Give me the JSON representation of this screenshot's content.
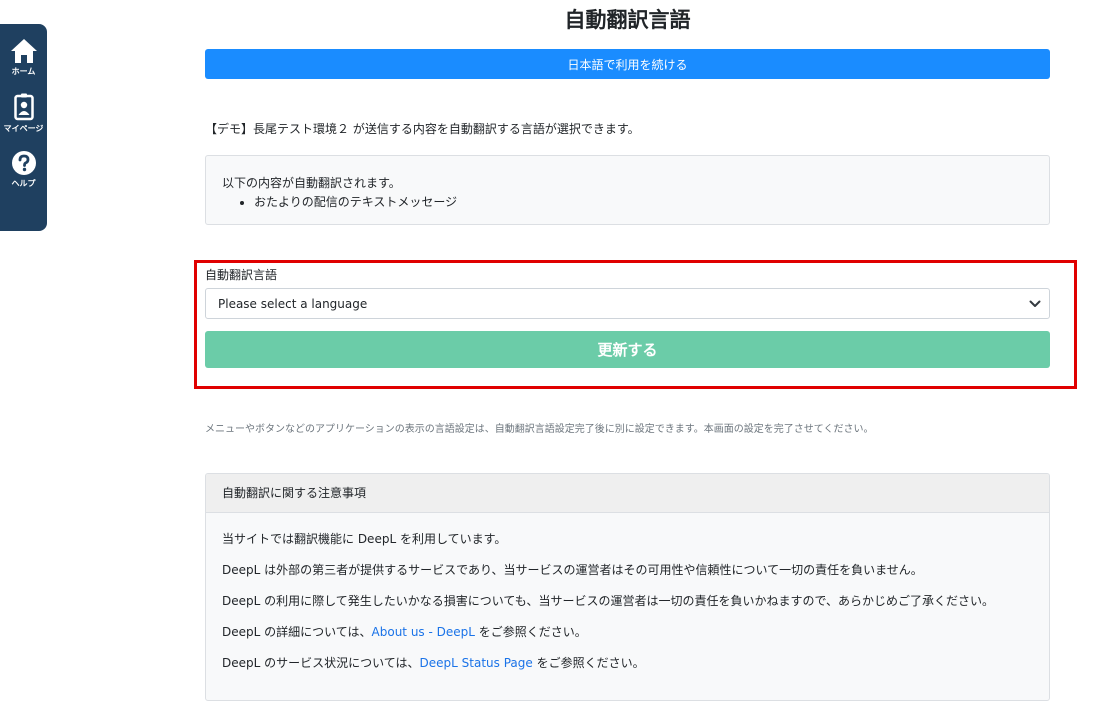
{
  "sidebar": {
    "items": [
      {
        "label": "ホーム",
        "icon": "home-icon"
      },
      {
        "label": "マイページ",
        "icon": "id-badge-icon"
      },
      {
        "label": "ヘルプ",
        "icon": "help-icon"
      }
    ]
  },
  "page": {
    "title": "自動翻訳言語",
    "continue_label": "日本語で利用を続ける",
    "intro": "【デモ】長尾テスト環境２ が送信する内容を自動翻訳する言語が選択できます。"
  },
  "info": {
    "heading": "以下の内容が自動翻訳されます。",
    "items": [
      "おたよりの配信のテキストメッセージ"
    ]
  },
  "form": {
    "label": "自動翻訳言語",
    "select_value": "Please select a language",
    "update_label": "更新する"
  },
  "note": "メニューやボタンなどのアプリケーションの表示の言語設定は、自動翻訳言語設定完了後に別に設定できます。本画面の設定を完了させてください。",
  "notice": {
    "title": "自動翻訳に関する注意事項",
    "line1": "当サイトでは翻訳機能に DeepL を利用しています。",
    "line2": "DeepL は外部の第三者が提供するサービスであり、当サービスの運営者はその可用性や信頼性について一切の責任を負いません。",
    "line3": "DeepL の利用に際して発生したいかなる損害についても、当サービスの運営者は一切の責任を負いかねますので、あらかじめご了承ください。",
    "line4_pre": "DeepL の詳細については、",
    "line4_link": "About us - DeepL",
    "line4_post": " をご参照ください。",
    "line5_pre": "DeepL のサービス状況については、",
    "line5_link": "DeepL Status Page",
    "line5_post": " をご参照ください。"
  },
  "colors": {
    "sidebar_bg": "#1f4060",
    "primary": "#1a8cff",
    "update_button": "#6bcca8",
    "highlight_border": "#e00000",
    "link": "#1a73e8"
  }
}
